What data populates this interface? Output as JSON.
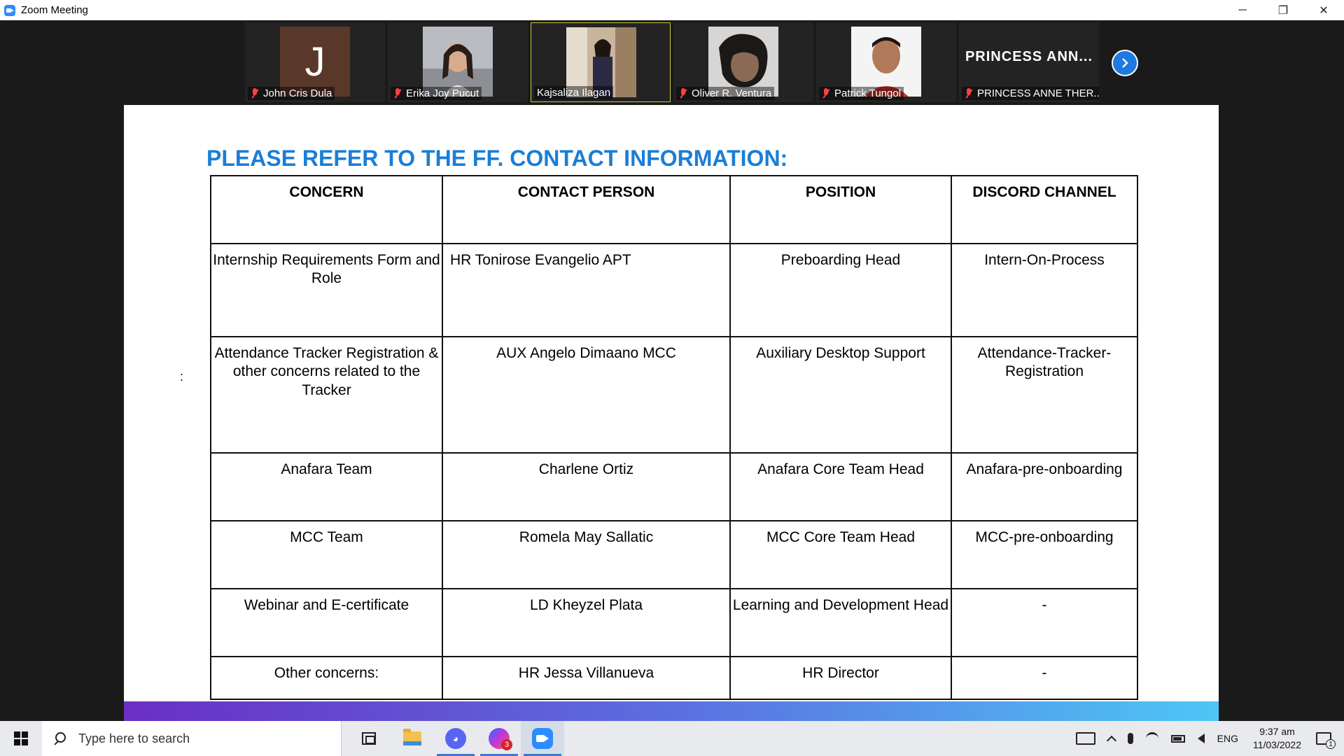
{
  "window": {
    "title": "Zoom Meeting",
    "minimize": "─",
    "restore": "❐",
    "close": "✕"
  },
  "participants": [
    {
      "name": "John Cris Dula",
      "avatar_letter": "J",
      "muted": true,
      "active": false,
      "avatar_color": "#5a3829"
    },
    {
      "name": "Erika Joy Pucut",
      "muted": true,
      "active": false
    },
    {
      "name": "Kajsaliza Ilagan",
      "muted": false,
      "active": true
    },
    {
      "name": "Oliver R. Ventura",
      "muted": true,
      "active": false
    },
    {
      "name": "Patrick Tungol",
      "muted": true,
      "active": false
    },
    {
      "name": "PRINCESS ANNE THER...",
      "display_title": "PRINCESS ANN...",
      "muted": true,
      "active": false
    }
  ],
  "slide": {
    "title": "PLEASE REFER TO THE FF. CONTACT INFORMATION:",
    "stray_mark": ":",
    "table": {
      "headers": [
        "CONCERN",
        "CONTACT PERSON",
        "POSITION",
        "DISCORD CHANNEL"
      ],
      "rows": [
        [
          "Internship Requirements Form and Role",
          "HR Tonirose Evangelio APT",
          "Preboarding Head",
          "Intern-On-Process"
        ],
        [
          "Attendance Tracker Registration & other concerns related to the Tracker",
          "AUX Angelo Dimaano MCC",
          "Auxiliary Desktop Support",
          "Attendance-Tracker-Registration"
        ],
        [
          "Anafara Team",
          "Charlene Ortiz",
          "Anafara Core Team Head",
          "Anafara-pre-onboarding"
        ],
        [
          "MCC Team",
          "Romela May Sallatic",
          "MCC Core Team Head",
          "MCC-pre-onboarding"
        ],
        [
          "Webinar and E-certificate",
          "LD Kheyzel Plata",
          "Learning and Development Head",
          "-"
        ],
        [
          "Other concerns:",
          "HR Jessa Villanueva",
          "HR Director",
          "-"
        ]
      ]
    },
    "accent_colors": {
      "title": "#1a7ed6",
      "bar_start": "#6a2fc4",
      "bar_end": "#4ec6f5"
    }
  },
  "taskbar": {
    "search_placeholder": "Type here to search",
    "messenger_badge": "3",
    "language": "ENG",
    "time": "9:37 am",
    "date": "11/03/2022",
    "notifications_count": "1"
  }
}
